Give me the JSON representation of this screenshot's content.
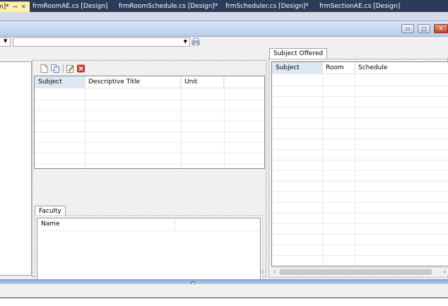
{
  "doc_tabs": [
    {
      "label": "n]*",
      "active": true
    },
    {
      "label": "frmRoomAE.cs [Design]"
    },
    {
      "label": "frmRoomSchedule.cs [Design]*"
    },
    {
      "label": "frmScheduler.cs [Design]*"
    },
    {
      "label": "frmSectionAE.cs [Design]"
    }
  ],
  "subjects_grid": {
    "columns": [
      "Subject",
      "Descriptive Title",
      "Unit"
    ]
  },
  "faculty_tab": "Faculty",
  "faculty_grid": {
    "columns": [
      "Name"
    ]
  },
  "offered_tab": "Subject Offered",
  "offered_grid": {
    "columns": [
      "Subject",
      "Room",
      "Schedule"
    ]
  },
  "icons": [
    "new-icon",
    "copy-icon",
    "edit-icon",
    "delete-icon",
    "print-icon",
    "pin-icon",
    "close-icon",
    "minimize-icon",
    "maximize-icon",
    "window-close-icon"
  ]
}
